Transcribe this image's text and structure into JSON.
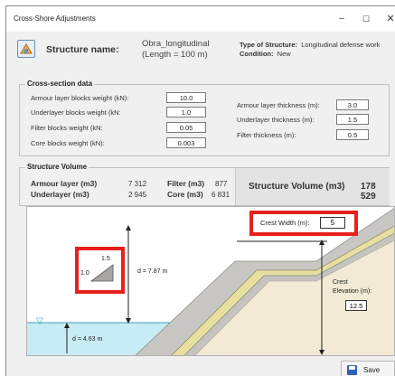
{
  "window": {
    "title": "Cross-Shore Adjustments",
    "buttons": {
      "minimize": "–",
      "maximize": "☐",
      "close": "✕"
    }
  },
  "header": {
    "structure_name_label": "Structure name:",
    "structure_name_value": "Obra_longitudinal",
    "structure_length": "(Length = 100 m)",
    "type_label": "Type of Structure:",
    "type_value": "Longitudinal defense work",
    "condition_label": "Condition:",
    "condition_value": "New"
  },
  "cross_section": {
    "title": "Cross-section data",
    "left_fields": [
      {
        "label": "Armour layer blocks weight (kN):",
        "value": "10.0"
      },
      {
        "label": "Underlayer blocks weight (kN:",
        "value": "1.0"
      },
      {
        "label": "Filter blocks weight (kN:",
        "value": "0.05"
      },
      {
        "label": "Core blocks weight (kN):",
        "value": "0.003"
      }
    ],
    "right_fields": [
      {
        "label": "Armour layer thickness (m):",
        "value": "3.0"
      },
      {
        "label": "Underlayer thickness (m):",
        "value": "1.5"
      },
      {
        "label": "Filter thickness (m):",
        "value": "0.5"
      }
    ]
  },
  "structure_volume": {
    "title": "Structure Volume",
    "armour_label": "Armour layer (m3)",
    "armour_value": "7 312",
    "underlayer_label": "Underlayer (m3)",
    "underlayer_value": "2 945",
    "filter_label": "Filter (m3)",
    "filter_value": "877",
    "core_label": "Core (m3)",
    "core_value": "6 831",
    "total_label": "Structure Volume (m3)",
    "total_value": "178 529"
  },
  "diagram": {
    "crest_width_label": "Crest Width (m):",
    "crest_width_value": "5",
    "slope_v": "1.5",
    "slope_h": "1.0",
    "d_height": "d = 7.87 m",
    "d_water": "d = 4.63 m",
    "crest_label": "Crest",
    "elevation_label": "Elevation (m):",
    "elevation_value": "12.5",
    "water_symbol": "▽",
    "colors": {
      "water": "#c8ecf4",
      "sand": "#f2ead4",
      "armour": "#c9c7c3",
      "underlayer": "#e6dfa0",
      "highlight": "#e8201c"
    }
  },
  "footer": {
    "save_label": "Save"
  }
}
